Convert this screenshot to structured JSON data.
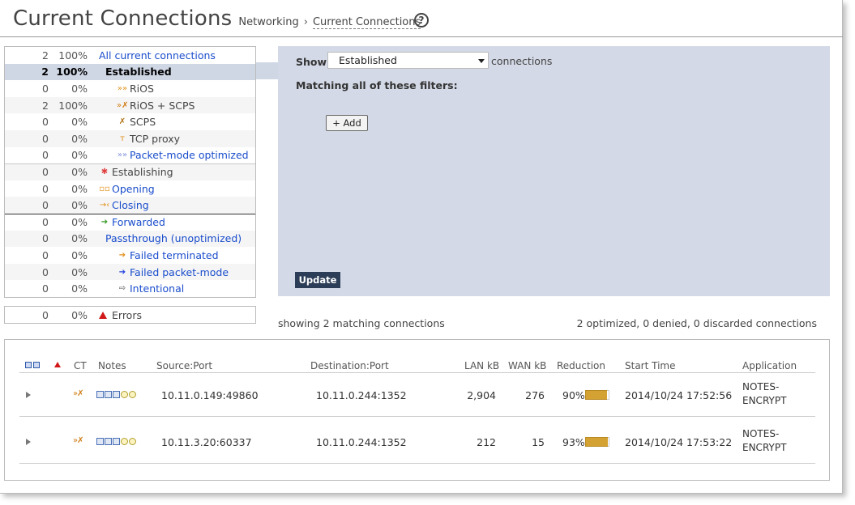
{
  "header": {
    "title": "Current Connections",
    "breadcrumb_parent": "Networking",
    "breadcrumb_sep": "›",
    "breadcrumb_current": "Current Connections",
    "help_glyph": "?"
  },
  "stats": [
    {
      "count": "2",
      "pct": "100%",
      "label": "All current connections",
      "icon": "",
      "style": "link",
      "indent": 0
    },
    {
      "count": "2",
      "pct": "100%",
      "label": "Established",
      "icon": "",
      "style": "selected",
      "indent": 1
    },
    {
      "count": "0",
      "pct": "0%",
      "label": "RiOS",
      "icon": "»»",
      "icon_color": "#e0901a",
      "style": "plain",
      "indent": 2
    },
    {
      "count": "2",
      "pct": "100%",
      "label": "RiOS + SCPS",
      "icon": "»✗",
      "icon_color": "#d07a10",
      "style": "plain",
      "indent": 2
    },
    {
      "count": "0",
      "pct": "0%",
      "label": "SCPS",
      "icon": "✗",
      "icon_color": "#b07010",
      "style": "plain",
      "indent": 2
    },
    {
      "count": "0",
      "pct": "0%",
      "label": "TCP proxy",
      "icon": "т",
      "icon_color": "#e0901a",
      "style": "plain",
      "indent": 2
    },
    {
      "count": "0",
      "pct": "0%",
      "label": "Packet-mode optimized",
      "icon": "»»",
      "icon_color": "#8090e0",
      "style": "link",
      "indent": 2
    },
    {
      "count": "0",
      "pct": "0%",
      "label": "Establishing",
      "icon": "✱",
      "icon_color": "#e04040",
      "style": "plain",
      "indent": 0,
      "sep": "light"
    },
    {
      "count": "0",
      "pct": "0%",
      "label": "Opening",
      "icon": "▫▫",
      "icon_color": "#e0901a",
      "style": "link",
      "indent": 0
    },
    {
      "count": "0",
      "pct": "0%",
      "label": "Closing",
      "icon": "→‹",
      "icon_color": "#e0901a",
      "style": "link",
      "indent": 0
    },
    {
      "count": "0",
      "pct": "0%",
      "label": "Forwarded",
      "icon": "➔",
      "icon_color": "#3a9a2a",
      "style": "link",
      "indent": 0,
      "sep": "dark"
    },
    {
      "count": "0",
      "pct": "0%",
      "label": "Passthrough (unoptimized)",
      "icon": "",
      "style": "link",
      "indent": 1
    },
    {
      "count": "0",
      "pct": "0%",
      "label": "Failed terminated",
      "icon": "➔",
      "icon_color": "#e0901a",
      "style": "link",
      "indent": 2
    },
    {
      "count": "0",
      "pct": "0%",
      "label": "Failed packet-mode",
      "icon": "➔",
      "icon_color": "#2040e0",
      "style": "link",
      "indent": 2
    },
    {
      "count": "0",
      "pct": "0%",
      "label": "Intentional",
      "icon": "⇨",
      "icon_color": "#555555",
      "style": "link",
      "indent": 2
    }
  ],
  "errors": {
    "count": "0",
    "pct": "0%",
    "label": "Errors"
  },
  "filter": {
    "show_label": "Show",
    "show_value": "Established",
    "connections_label": "connections",
    "matching_label": "Matching all of these filters:",
    "add_label": "+ Add",
    "update_label": "Update"
  },
  "results": {
    "showing": "showing 2 matching connections",
    "summary": "2 optimized, 0 denied, 0 discarded connections"
  },
  "table": {
    "headers": {
      "ct": "CT",
      "notes": "Notes",
      "source": "Source:Port",
      "destination": "Destination:Port",
      "lan": "LAN kB",
      "wan": "WAN kB",
      "reduction": "Reduction",
      "start": "Start Time",
      "application": "Application"
    },
    "rows": [
      {
        "source": "10.11.0.149:49860",
        "destination": "10.11.0.244:1352",
        "lan": "2,904",
        "wan": "276",
        "reduction": "90%",
        "reduction_value": 0.9,
        "start": "2014/10/24 17:52:56",
        "app_line1": "NOTES-",
        "app_line2": "ENCRYPT"
      },
      {
        "source": "10.11.3.20:60337",
        "destination": "10.11.0.244:1352",
        "lan": "212",
        "wan": "15",
        "reduction": "93%",
        "reduction_value": 0.93,
        "start": "2014/10/24 17:53:22",
        "app_line1": "NOTES-",
        "app_line2": "ENCRYPT"
      }
    ]
  },
  "colors": {
    "accent_link": "#1a4dcc",
    "selected_row": "#cfd6e4",
    "filter_panel": "#d3d9e6",
    "update_button": "#2c3e57",
    "reduction_bar": "#d4a233"
  }
}
